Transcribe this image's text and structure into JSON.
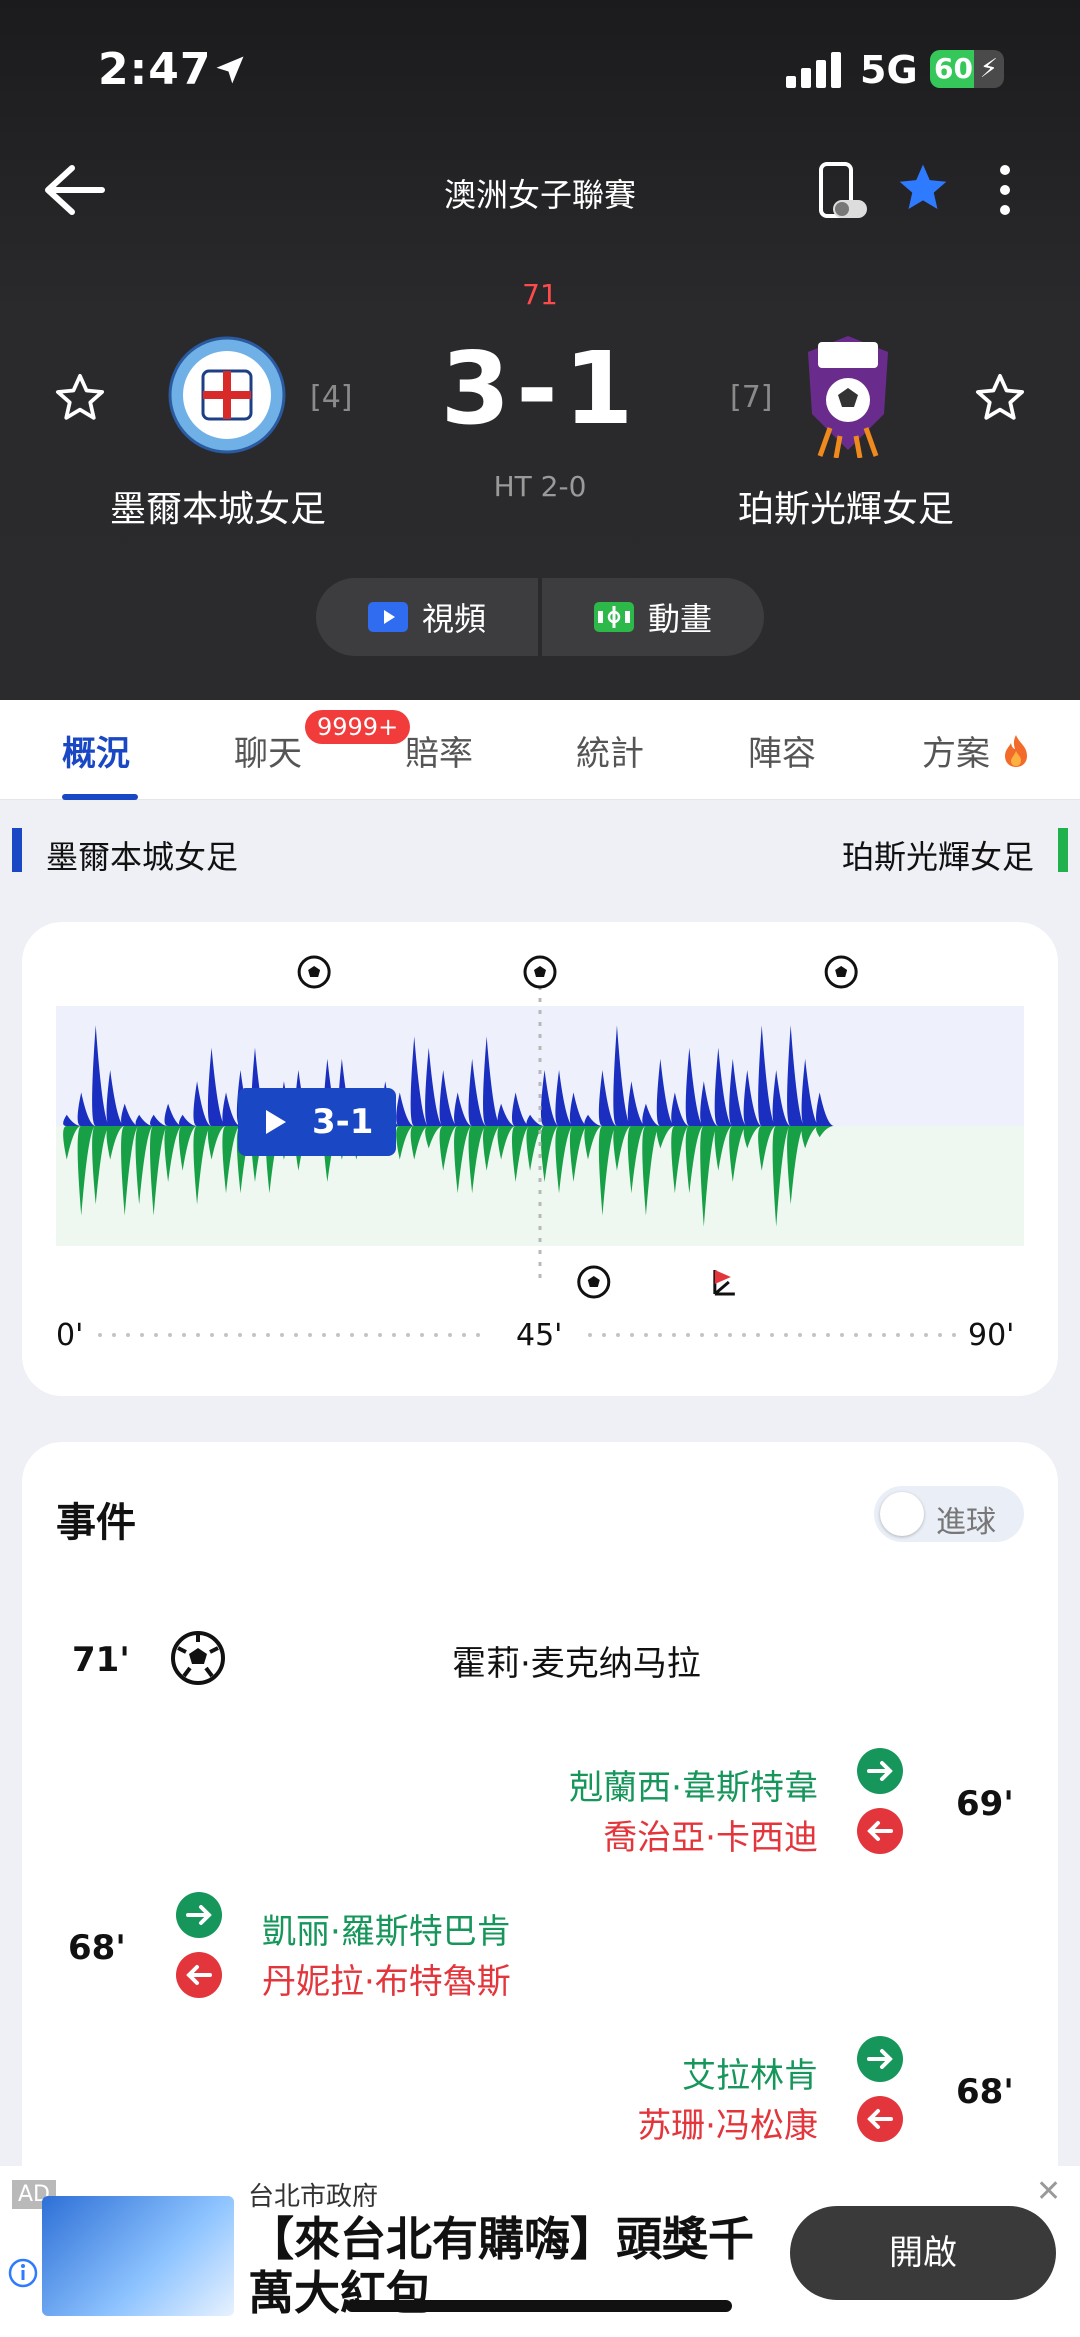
{
  "status_bar": {
    "time": "2:47",
    "network": "5G",
    "battery": "60",
    "battery_level": 0.6
  },
  "header": {
    "league": "澳洲女子聯賽",
    "minute": "71",
    "score": "3-1",
    "halftime": "HT 2-0",
    "home": {
      "name": "墨爾本城女足",
      "rank": "[4]"
    },
    "away": {
      "name": "珀斯光輝女足",
      "rank": "[7]"
    },
    "media": {
      "video": "視頻",
      "animation": "動畫"
    }
  },
  "tabs": [
    {
      "label": "概況",
      "active": true
    },
    {
      "label": "聊天",
      "badge": "9999+"
    },
    {
      "label": "賠率"
    },
    {
      "label": "統計"
    },
    {
      "label": "陣容"
    },
    {
      "label": "方案"
    }
  ],
  "team_bar": {
    "home": "墨爾本城女足",
    "away": "珀斯光輝女足"
  },
  "momentum": {
    "axis": [
      "0'",
      "45'",
      "90'"
    ],
    "home_color": "#1a2fbf",
    "away_color": "#18a046",
    "home_bg": "#eef0fb",
    "away_bg": "#eef7f0",
    "home_values": [
      0.1,
      0.3,
      0.9,
      0.5,
      0.2,
      0.1,
      0.1,
      0.2,
      0.1,
      0.4,
      0.7,
      0.3,
      0.5,
      0.7,
      0.2,
      0.4,
      0.5,
      0.3,
      0.6,
      0.6,
      0.2,
      0.3,
      0.4,
      0.3,
      0.8,
      0.7,
      0.5,
      0.3,
      0.6,
      0.8,
      0.2,
      0.3,
      0.1,
      0.5,
      0.5,
      0.3,
      0.1,
      0.5,
      0.9,
      0.4,
      0.2,
      0.6,
      0.3,
      0.7,
      0.4,
      0.7,
      0.6,
      0.5,
      0.9,
      0.5,
      0.9,
      0.6,
      0.3
    ],
    "away_values": [
      0.3,
      0.8,
      0.7,
      0.3,
      0.8,
      0.7,
      0.8,
      0.5,
      0.4,
      0.7,
      0.3,
      0.6,
      0.6,
      0.5,
      0.6,
      0.3,
      0.4,
      0.2,
      0.5,
      0.3,
      0.3,
      0.2,
      0.2,
      0.3,
      0.3,
      0.2,
      0.4,
      0.6,
      0.6,
      0.4,
      0.3,
      0.5,
      0.4,
      0.5,
      0.6,
      0.5,
      0.3,
      0.8,
      0.4,
      0.6,
      0.8,
      0.2,
      0.6,
      0.6,
      0.9,
      0.4,
      0.5,
      0.2,
      0.4,
      0.9,
      0.7,
      0.2,
      0.1
    ],
    "home_goal_minutes": [
      24,
      45,
      73
    ],
    "away_goal_minutes": [
      50
    ],
    "corner_minutes": [
      62
    ]
  },
  "events": {
    "title": "事件",
    "toggle_label": "進球",
    "items": [
      {
        "side": "home",
        "minute": "71'",
        "type": "goal",
        "score": "3-1",
        "player": "霍莉·麦克纳马拉"
      },
      {
        "side": "away",
        "minute": "69'",
        "type": "sub",
        "in": "剋蘭西·韋斯特韋",
        "out": "喬治亞·卡西迪"
      },
      {
        "side": "home",
        "minute": "68'",
        "type": "sub",
        "in": "凱丽·羅斯特巴肯",
        "out": "丹妮拉·布特魯斯"
      },
      {
        "side": "away",
        "minute": "68'",
        "type": "sub",
        "in": "艾拉林肯",
        "out": "苏珊·冯松康"
      }
    ]
  },
  "ad": {
    "tag": "AD",
    "source": "台北市政府",
    "title": "【來台北有購嗨】頭獎千萬大紅包",
    "button": "開啟"
  }
}
